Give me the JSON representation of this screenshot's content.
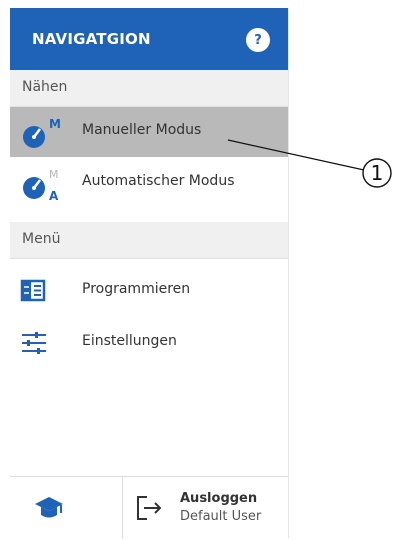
{
  "navigation": {
    "title": "NAVIGATGION",
    "help_label": "?"
  },
  "sections": {
    "sewing_label": "Nähen",
    "menu_label": "Menü"
  },
  "items": {
    "manual_mode": {
      "label": "Manueller Modus",
      "icon_letter": "M",
      "selected": true
    },
    "auto_mode": {
      "label": "Automatischer Modus",
      "icon_letter_top": "M",
      "icon_letter_bottom": "A"
    },
    "program": {
      "label": "Programmieren"
    },
    "settings": {
      "label": "Einstellungen"
    }
  },
  "footer": {
    "logout_label": "Ausloggen",
    "logout_user": "Default User"
  },
  "callout": {
    "number": "1"
  },
  "colors": {
    "header_bg": "#1e63b8",
    "selected_bg": "#b9b9b9",
    "section_bg": "#f0f0f0",
    "icon_blue": "#1e63b8"
  },
  "icons": {
    "help": "help-icon",
    "manual_mode": "gauge-m-icon",
    "auto_mode": "gauge-a-icon",
    "program": "program-grid-icon",
    "settings": "sliders-icon",
    "education": "graduation-cap-icon",
    "logout": "logout-arrow-icon"
  }
}
